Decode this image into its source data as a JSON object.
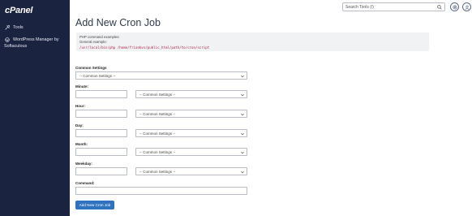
{
  "sidebar": {
    "logo": "cPanel",
    "items": [
      {
        "label": "Tools"
      },
      {
        "label": "WordPress Manager by",
        "sub": "Softaculous"
      }
    ]
  },
  "topbar": {
    "search_placeholder": "Search Tools (/)"
  },
  "page": {
    "title": "Add New Cron Job",
    "examples": {
      "heading": "PHP command examples:",
      "general": "General example:",
      "code": "/usr/local/bin/php /home/frianbvs/public_html/path/to/cron/script"
    },
    "common_settings_label": "Common Settings",
    "common_settings_value": "-- Common Settings --",
    "fields": [
      {
        "label": "Minute:",
        "select": "-- Common Settings --"
      },
      {
        "label": "Hour:",
        "select": "-- Common Settings --"
      },
      {
        "label": "Day:",
        "select": "-- Common Settings --"
      },
      {
        "label": "Month:",
        "select": "-- Common Settings --"
      },
      {
        "label": "Weekday:",
        "select": "-- Common Settings --"
      }
    ],
    "command_label": "Command:",
    "submit_label": "Add New Cron Job"
  }
}
